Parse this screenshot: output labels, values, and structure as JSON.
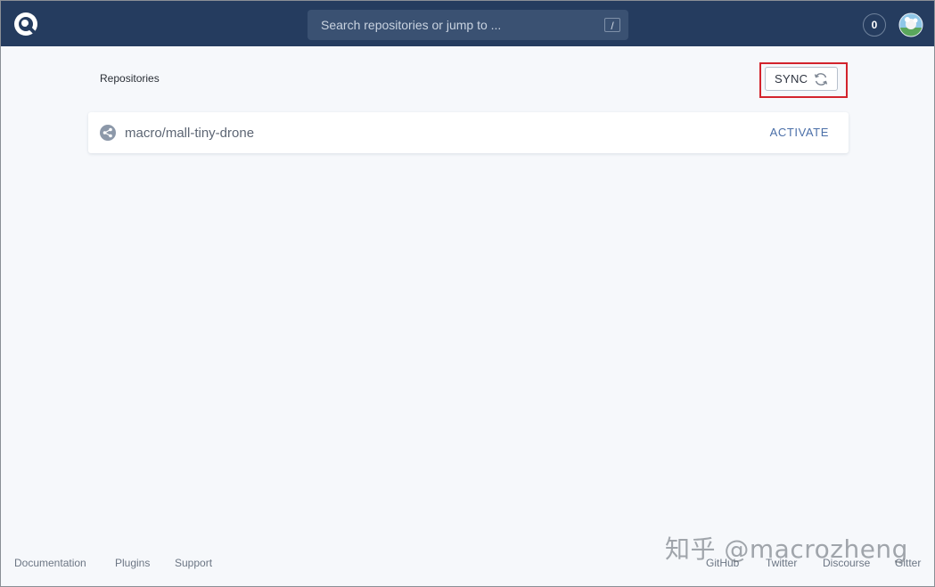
{
  "header": {
    "search": {
      "placeholder": "Search repositories or jump to ...",
      "shortcut_key": "/"
    },
    "notification_count": "0"
  },
  "main": {
    "section_title": "Repositories",
    "sync_button": {
      "label": "SYNC"
    },
    "repositories": [
      {
        "name": "macro/mall-tiny-drone",
        "action_label": "ACTIVATE"
      }
    ]
  },
  "footer": {
    "left_links": [
      "Documentation",
      "Plugins",
      "Support"
    ],
    "right_links": [
      "GitHub",
      "Twitter",
      "Discourse",
      "Gitter"
    ]
  },
  "watermark": "知乎 @macrozheng",
  "colors": {
    "header_bg": "#253c5f",
    "page_bg": "#f6f8fb",
    "accent": "#4b6fa8",
    "highlight": "#d3232c"
  },
  "icons": {
    "logo": "drone-logo-icon",
    "avatar": "user-avatar",
    "sync": "refresh-icon",
    "repo": "share-icon"
  }
}
